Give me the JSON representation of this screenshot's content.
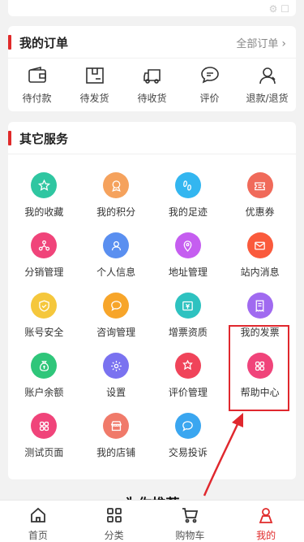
{
  "orders": {
    "title": "我的订单",
    "all_link": "全部订单",
    "items": [
      {
        "label": "待付款",
        "icon": "wallet-icon"
      },
      {
        "label": "待发货",
        "icon": "package-icon"
      },
      {
        "label": "待收货",
        "icon": "truck-icon"
      },
      {
        "label": "评价",
        "icon": "comment-icon"
      },
      {
        "label": "退款/退货",
        "icon": "refund-icon"
      }
    ]
  },
  "services": {
    "title": "其它服务",
    "items": [
      {
        "label": "我的收藏",
        "icon": "star-icon",
        "color": "#2fc6a1"
      },
      {
        "label": "我的积分",
        "icon": "medal-icon",
        "color": "#f5a25d"
      },
      {
        "label": "我的足迹",
        "icon": "footprint-icon",
        "color": "#33b6f0"
      },
      {
        "label": "优惠券",
        "icon": "coupon-icon",
        "color": "#f06a5a"
      },
      {
        "label": "分销管理",
        "icon": "distribution-icon",
        "color": "#f0447a"
      },
      {
        "label": "个人信息",
        "icon": "person-icon",
        "color": "#5a8ff0"
      },
      {
        "label": "地址管理",
        "icon": "location-icon",
        "color": "#c55ef0"
      },
      {
        "label": "站内消息",
        "icon": "mail-icon",
        "color": "#fa5a3c"
      },
      {
        "label": "账号安全",
        "icon": "shield-icon",
        "color": "#f5c73c"
      },
      {
        "label": "咨询管理",
        "icon": "chat-bubble-icon",
        "color": "#f7a52a"
      },
      {
        "label": "增票资质",
        "icon": "ticket-icon",
        "color": "#2ec2c0"
      },
      {
        "label": "我的发票",
        "icon": "invoice-icon",
        "color": "#a06af0"
      },
      {
        "label": "账户余额",
        "icon": "money-bag-icon",
        "color": "#2fc67a"
      },
      {
        "label": "设置",
        "icon": "gear-icon",
        "color": "#7a72f0"
      },
      {
        "label": "评价管理",
        "icon": "review-icon",
        "color": "#f0445a"
      },
      {
        "label": "帮助中心",
        "icon": "grid-icon",
        "color": "#f0447a"
      },
      {
        "label": "测试页面",
        "icon": "grid-icon",
        "color": "#f0447a"
      },
      {
        "label": "我的店铺",
        "icon": "store-icon",
        "color": "#f07a6a"
      },
      {
        "label": "交易投诉",
        "icon": "complaint-icon",
        "color": "#3aa6f0"
      }
    ]
  },
  "recommend_title": "为你推荐",
  "tabbar": {
    "items": [
      {
        "label": "首页",
        "icon": "home-icon",
        "active": false
      },
      {
        "label": "分类",
        "icon": "category-icon",
        "active": false
      },
      {
        "label": "购物车",
        "icon": "cart-icon",
        "active": false
      },
      {
        "label": "我的",
        "icon": "user-icon",
        "active": true
      }
    ]
  },
  "colors": {
    "accent": "#e02a2a",
    "annotation": "#e0282e"
  }
}
